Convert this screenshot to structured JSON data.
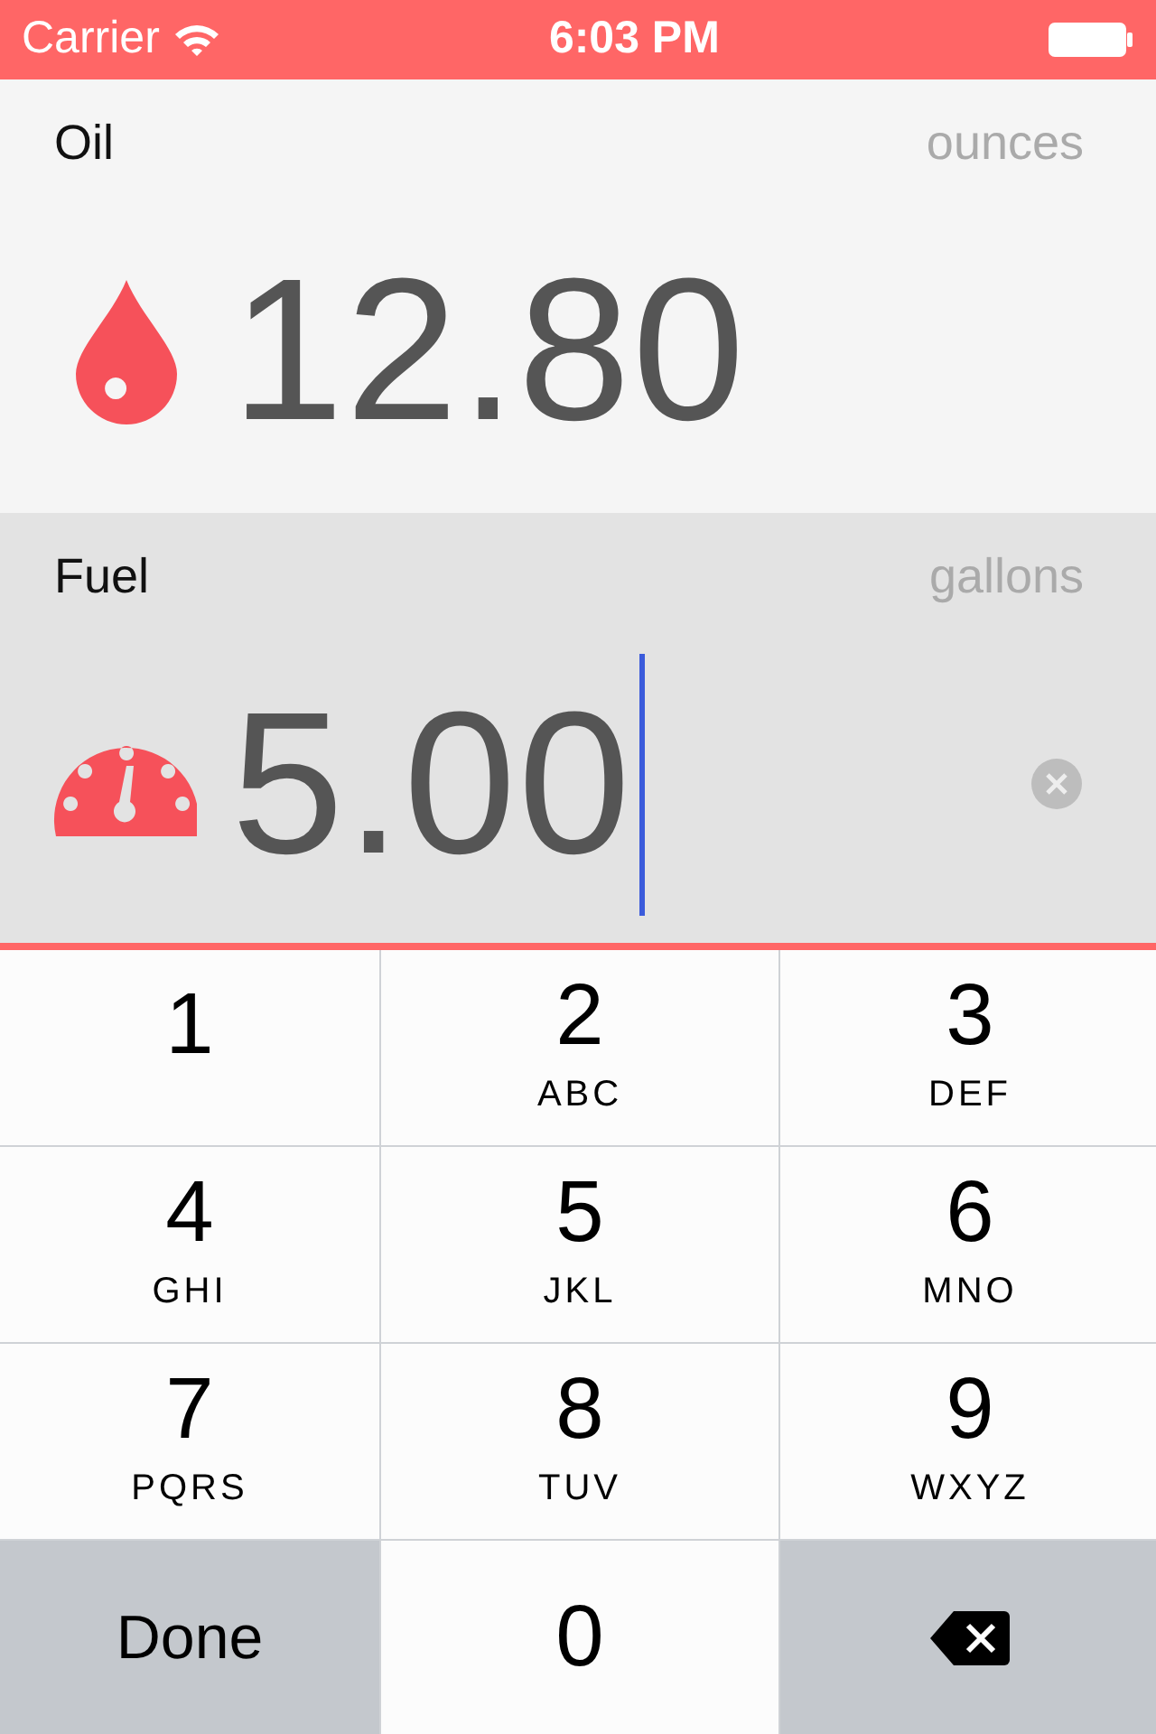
{
  "status_bar": {
    "carrier": "Carrier",
    "time": "6:03 PM"
  },
  "fields": [
    {
      "label": "Oil",
      "unit": "ounces",
      "value": "12.80",
      "kind": "drop",
      "selected": false
    },
    {
      "label": "Fuel",
      "unit": "gallons",
      "value": "5.00",
      "kind": "gauge",
      "selected": true
    }
  ],
  "keypad": [
    {
      "kind": "digit",
      "digit": "1"
    },
    {
      "kind": "digit",
      "digit": "2",
      "letters": "ABC"
    },
    {
      "kind": "digit",
      "digit": "3",
      "letters": "DEF"
    },
    {
      "kind": "digit",
      "digit": "4",
      "letters": "GHI"
    },
    {
      "kind": "digit",
      "digit": "5",
      "letters": "JKL"
    },
    {
      "kind": "digit",
      "digit": "6",
      "letters": "MNO"
    },
    {
      "kind": "digit",
      "digit": "7",
      "letters": "PQRS"
    },
    {
      "kind": "digit",
      "digit": "8",
      "letters": "TUV"
    },
    {
      "kind": "digit",
      "digit": "9",
      "letters": "WXYZ"
    },
    {
      "kind": "done",
      "label": "Done"
    },
    {
      "kind": "digit",
      "digit": "0"
    },
    {
      "kind": "delete"
    }
  ]
}
